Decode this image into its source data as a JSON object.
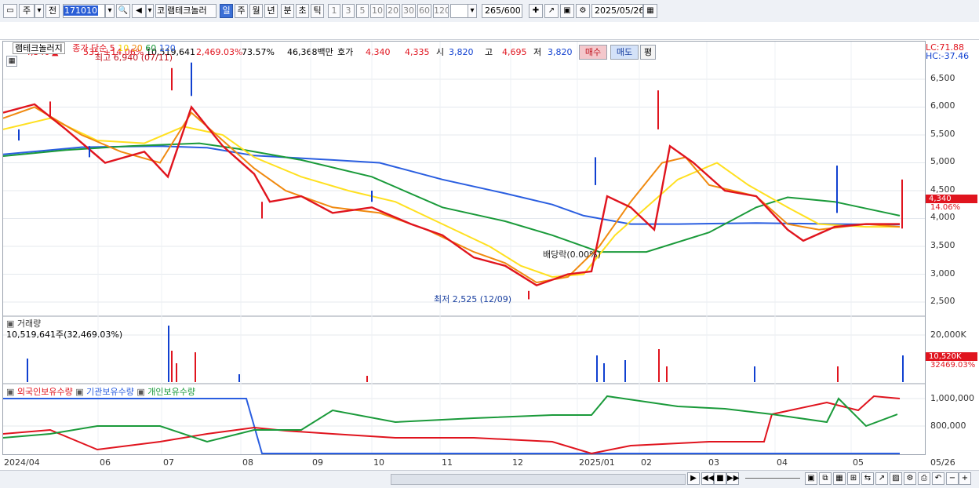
{
  "toolbar": {
    "market": "주",
    "prev": "전",
    "code": "171010",
    "stock_prefix": "코",
    "stock_name": "램테크놀러",
    "periods": [
      "일",
      "주",
      "월",
      "년",
      "분",
      "초",
      "틱"
    ],
    "selected_period": "일",
    "intervals": [
      "1",
      "3",
      "5",
      "10",
      "20",
      "30",
      "60",
      "120"
    ],
    "count": "265",
    "count_max": "/600",
    "date": "2025/05/26"
  },
  "quote": {
    "price": "4,340",
    "arrow": "▲",
    "change": "535",
    "change_pct": "+14.06%",
    "volume": "10,519,641",
    "volume_pct": "2,469.03%",
    "turnover": "73.57%",
    "amount": "46,368백만",
    "bid_label": "호가",
    "bid1": "4,340",
    "bid2": "4,335",
    "open_label": "시",
    "open": "3,820",
    "high_label": "고",
    "high": "4,695",
    "low_label": "저",
    "low": "3,820",
    "buy": "매수",
    "sell": "매도",
    "eval": "평"
  },
  "price_panel": {
    "name": "램테크놀러지",
    "ma_label": "종가 단순",
    "ma_periods": [
      "5",
      "10",
      "20",
      "60",
      "120"
    ],
    "high_annot": "최고 6,940 (07/11)",
    "low_annot": "최저 2,525 (12/09)",
    "dividend_annot": "배당락(0.00%)",
    "lc": "LC:71.88",
    "hc": "HC:-37.46",
    "last_price": "4,340",
    "last_pct": "14.06%",
    "y_ticks": [
      "6,500",
      "6,000",
      "5,500",
      "5,000",
      "4,500",
      "4,000",
      "3,500",
      "3,000",
      "2,500"
    ]
  },
  "volume_panel": {
    "title": "거래량",
    "value": "10,519,641주(32,469.03%)",
    "y_ticks": [
      "20,000K",
      "10,000K"
    ],
    "last": "10,520K",
    "last_pct": "32469.03%"
  },
  "holding_panel": {
    "series": [
      "외국인보유수량",
      "기관보유수량",
      "개인보유수량"
    ],
    "y_ticks": [
      "1,000,000",
      "800,000"
    ]
  },
  "x_labels": [
    "2024/04",
    "06",
    "07",
    "08",
    "09",
    "10",
    "11",
    "12",
    "2025/01",
    "02",
    "03",
    "04",
    "05",
    "05/26"
  ],
  "colors": {
    "up": "#e0141e",
    "down": "#1040d0",
    "ma5": "#e0141e",
    "ma10": "#f08a10",
    "ma20": "#ffe020",
    "ma60": "#1a9a3a",
    "ma120": "#2a5ee0"
  }
}
